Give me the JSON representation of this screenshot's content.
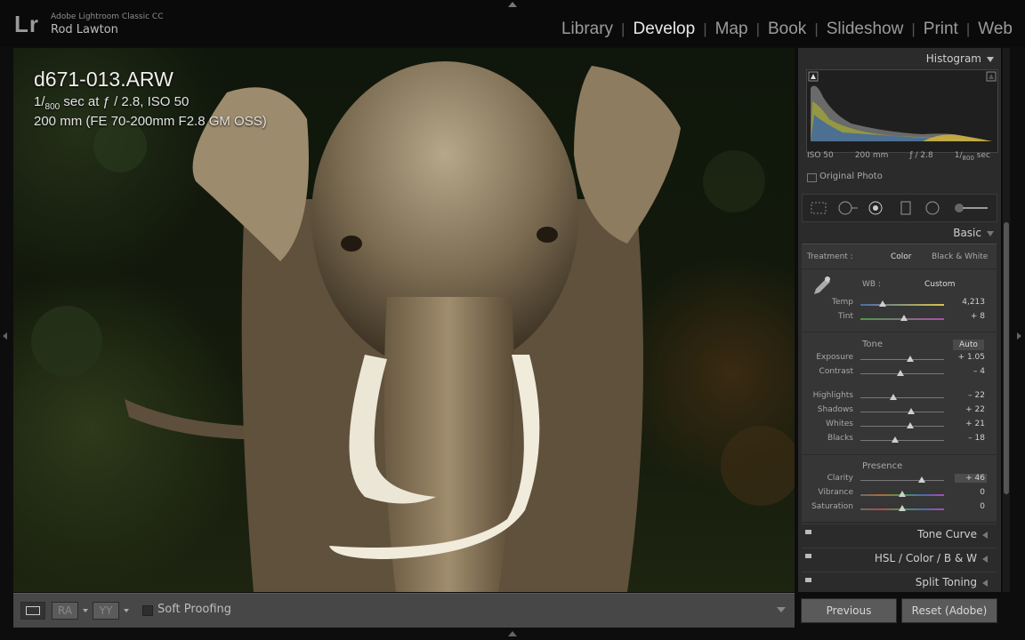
{
  "app": {
    "logo": "Lr",
    "name": "Adobe Lightroom Classic CC",
    "user": "Rod Lawton"
  },
  "modules": [
    {
      "label": "Library",
      "active": false
    },
    {
      "label": "Develop",
      "active": true
    },
    {
      "label": "Map",
      "active": false
    },
    {
      "label": "Book",
      "active": false
    },
    {
      "label": "Slideshow",
      "active": false
    },
    {
      "label": "Print",
      "active": false
    },
    {
      "label": "Web",
      "active": false
    }
  ],
  "photo": {
    "filename": "d671-013.ARW",
    "exposure_prefix": "1/",
    "exposure_denom": "800",
    "exposure_rest": " sec at ƒ / 2.8, ISO 50",
    "lens": "200 mm (FE 70-200mm F2.8 GM OSS)"
  },
  "toolbar": {
    "ra_label": "RA",
    "yy_label": "YY",
    "soft_proofing": "Soft Proofing"
  },
  "histogram": {
    "title": "Histogram",
    "iso": "ISO 50",
    "focal": "200 mm",
    "aperture": "ƒ / 2.8",
    "shutter_prefix": "1/",
    "shutter_denom": "800",
    "shutter_unit": " sec",
    "original_photo": "Original Photo"
  },
  "basic": {
    "title": "Basic",
    "treatment_label": "Treatment :",
    "treatment_color": "Color",
    "treatment_bw": "Black & White",
    "wb_label": "WB :",
    "wb_value": "Custom",
    "tone_label": "Tone",
    "auto_label": "Auto",
    "presence_label": "Presence",
    "sliders": [
      {
        "label": "Temp",
        "value": "4,213",
        "pos": 0.27
      },
      {
        "label": "Tint",
        "value": "+ 8",
        "pos": 0.52
      },
      {
        "label": "Exposure",
        "value": "+ 1.05",
        "pos": 0.6
      },
      {
        "label": "Contrast",
        "value": "– 4",
        "pos": 0.48
      },
      {
        "label": "Highlights",
        "value": "– 22",
        "pos": 0.39
      },
      {
        "label": "Shadows",
        "value": "+ 22",
        "pos": 0.61
      },
      {
        "label": "Whites",
        "value": "+ 21",
        "pos": 0.6
      },
      {
        "label": "Blacks",
        "value": "– 18",
        "pos": 0.41
      },
      {
        "label": "Clarity",
        "value": "+ 46",
        "pos": 0.73
      },
      {
        "label": "Vibrance",
        "value": "0",
        "pos": 0.5
      },
      {
        "label": "Saturation",
        "value": "0",
        "pos": 0.5
      }
    ]
  },
  "collapsed_panels": [
    "Tone Curve",
    "HSL / Color / B & W",
    "Split Toning"
  ],
  "buttons": {
    "previous": "Previous",
    "reset": "Reset (Adobe)"
  },
  "colors": {
    "accent_active": "#e8e8e8",
    "panel_bg": "#2b2b2b"
  }
}
